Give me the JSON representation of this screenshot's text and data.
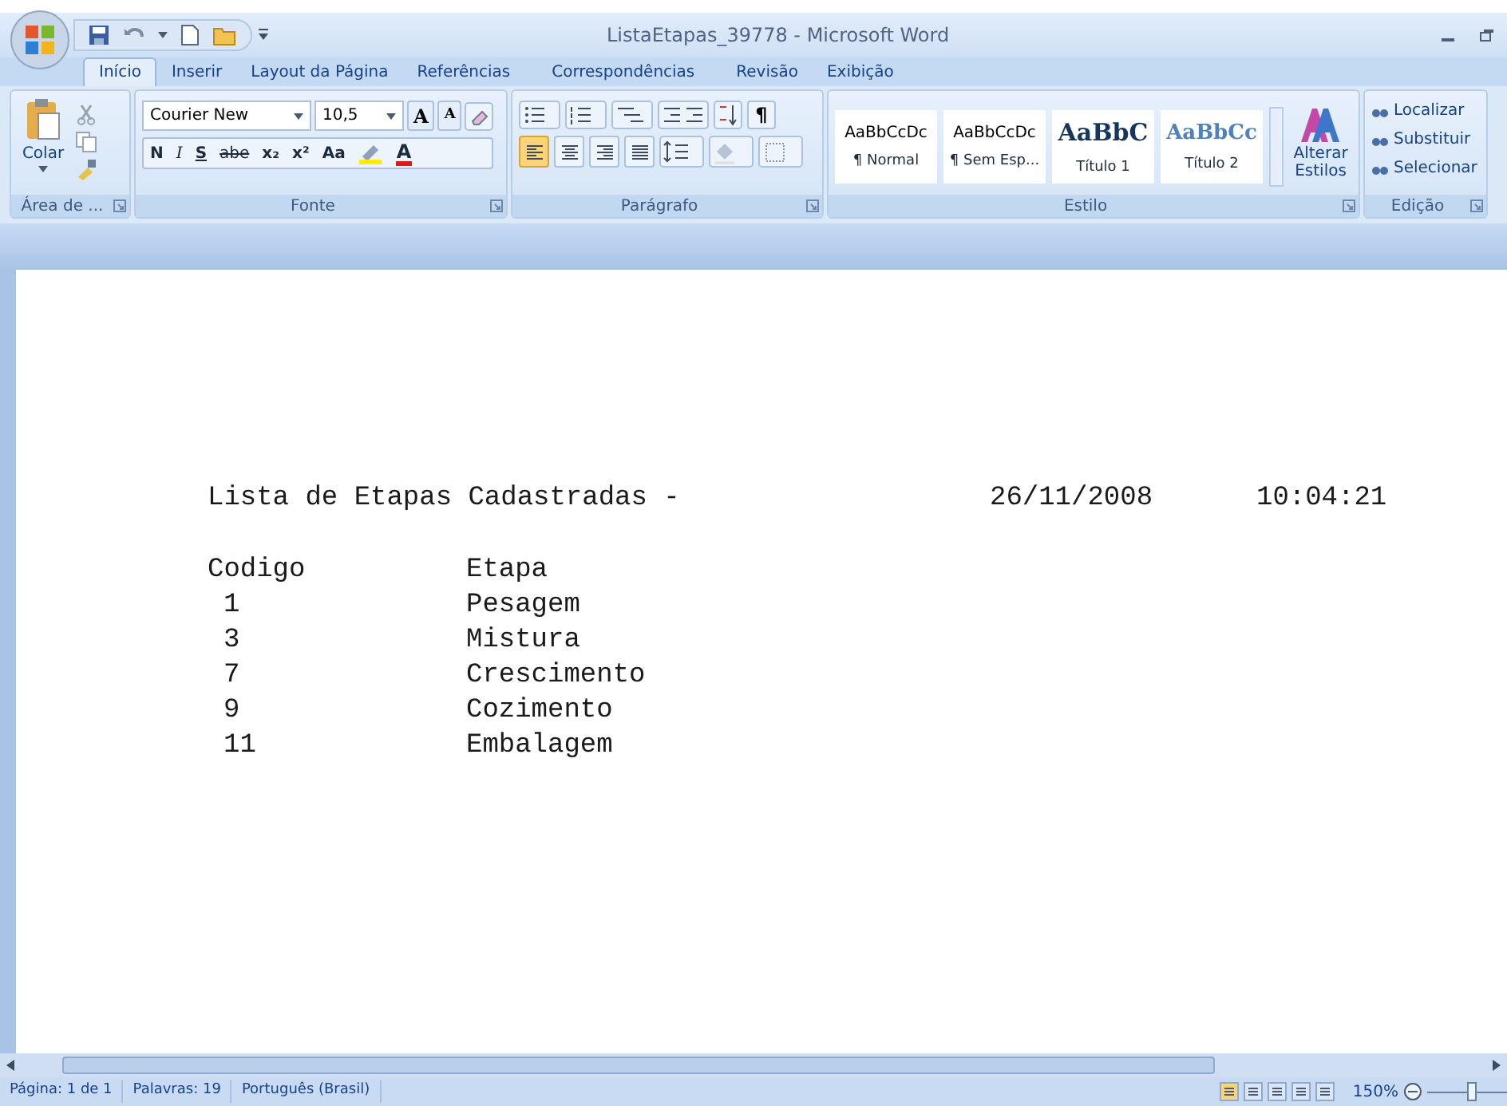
{
  "window": {
    "title": "ListaEtapas_39778 - Microsoft Word"
  },
  "tabs": [
    {
      "label": "Início",
      "selected": true
    },
    {
      "label": "Inserir",
      "selected": false
    },
    {
      "label": "Layout da Página",
      "selected": false
    },
    {
      "label": "Referências",
      "selected": false
    },
    {
      "label": "Correspondências",
      "selected": false
    },
    {
      "label": "Revisão",
      "selected": false
    },
    {
      "label": "Exibição",
      "selected": false
    }
  ],
  "clipboard": {
    "paste": "Colar",
    "group": "Área de ..."
  },
  "font": {
    "name": "Courier New",
    "size": "10,5",
    "group": "Fonte",
    "buttons": [
      {
        "label": "N",
        "kind": "bold"
      },
      {
        "label": "I",
        "kind": "italic"
      },
      {
        "label": "S",
        "kind": "underline"
      },
      {
        "label": "abe",
        "kind": "strike"
      },
      {
        "label": "x₂",
        "kind": "plain"
      },
      {
        "label": "x²",
        "kind": "plain"
      },
      {
        "label": "Aa",
        "kind": "plain"
      }
    ],
    "grow": "A",
    "shrink": "A",
    "color_letter": "A"
  },
  "paragraph": {
    "group": "Parágrafo",
    "alignments": [
      {
        "kind": "left",
        "selected": true
      },
      {
        "kind": "center",
        "selected": false
      },
      {
        "kind": "right",
        "selected": false
      },
      {
        "kind": "justify",
        "selected": false
      }
    ],
    "pilcrow": "¶"
  },
  "styles": {
    "group": "Estilo",
    "items": [
      {
        "sample": "AaBbCcDc",
        "label": "¶ Normal",
        "kind": "body"
      },
      {
        "sample": "AaBbCcDc",
        "label": "¶ Sem Esp...",
        "kind": "body"
      },
      {
        "sample": "AaBbC",
        "label": "Título 1",
        "kind": "heading1"
      },
      {
        "sample": "AaBbCc",
        "label": "Título 2",
        "kind": "heading2"
      }
    ],
    "change": "Alterar Estilos"
  },
  "editing": {
    "group": "Edição",
    "items": [
      "Localizar",
      "Substituir",
      "Selecionar"
    ]
  },
  "document": {
    "heading": "Lista de Etapas Cadastradas -",
    "date": "26/11/2008",
    "time": "10:04:21",
    "columns": [
      "Codigo",
      "Etapa"
    ],
    "rows": [
      [
        "1",
        "Pesagem"
      ],
      [
        "3",
        "Mistura"
      ],
      [
        "7",
        "Crescimento"
      ],
      [
        "9",
        "Cozimento"
      ],
      [
        "11",
        "Embalagem"
      ]
    ]
  },
  "status_bar": {
    "page": "Página: 1 de 1",
    "words": "Palavras: 19",
    "language": "Português (Brasil)",
    "zoom": "150%",
    "zoom_level": {
      "level": 0.55
    }
  }
}
